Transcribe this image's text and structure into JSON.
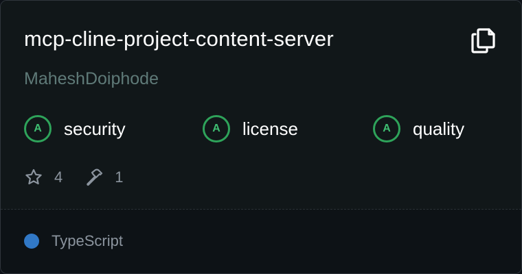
{
  "card": {
    "title": "mcp-cline-project-content-server",
    "author": "MaheshDoiphode",
    "copy_icon": "copy-icon"
  },
  "metrics": [
    {
      "grade": "A",
      "label": "security"
    },
    {
      "grade": "A",
      "label": "license"
    },
    {
      "grade": "A",
      "label": "quality"
    }
  ],
  "stats": {
    "stars": "4",
    "star_icon": "star-icon",
    "tools": "1",
    "tool_icon": "hammer-icon"
  },
  "language": {
    "name": "TypeScript",
    "color": "#3178c6"
  },
  "colors": {
    "background": "#111719",
    "grade_green": "#2ea35a",
    "muted_text": "#8b949e",
    "author_text": "#5f7a78"
  }
}
